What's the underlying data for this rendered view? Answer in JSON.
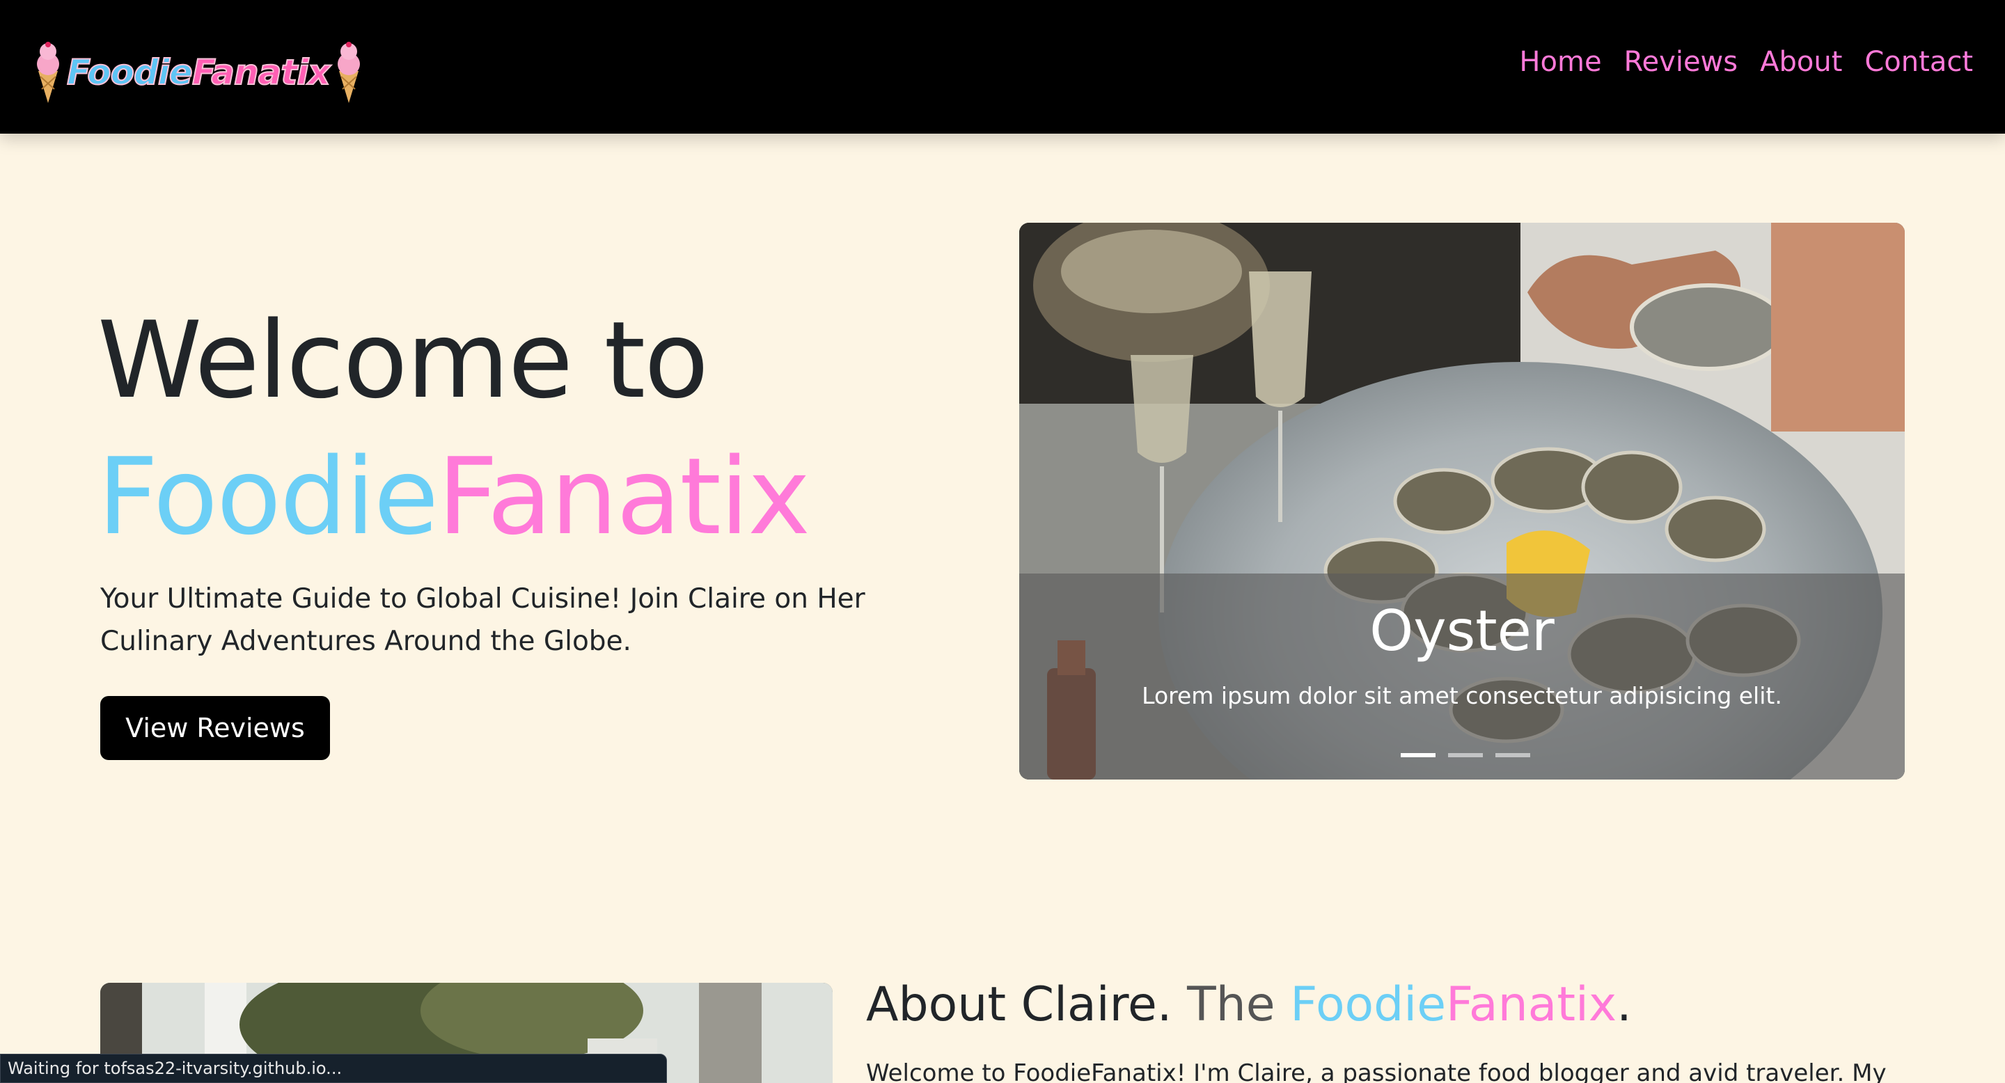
{
  "brand": {
    "part1": "Foodie",
    "part2": "Fanatix"
  },
  "nav": {
    "items": [
      "Home",
      "Reviews",
      "About",
      "Contact"
    ]
  },
  "hero": {
    "title_line1": "Welcome to",
    "title_part1": "Foodie",
    "title_part2": "Fanatix",
    "subtitle": "Your Ultimate Guide to Global Cuisine! Join Claire on Her Culinary Adventures Around the Globe.",
    "button": "View Reviews"
  },
  "carousel": {
    "caption_title": "Oyster",
    "caption_text": "Lorem ipsum dolor sit amet consectetur adipisicing elit.",
    "slide_count": 3,
    "active_slide": 1
  },
  "about": {
    "heading_part1": "About Claire.",
    "heading_part2": "The",
    "heading_part3": "Foodie",
    "heading_part4": "Fanatix",
    "heading_part5": ".",
    "text": "Welcome to FoodieFanatix! I'm Claire, a passionate food blogger and avid traveler. My"
  },
  "status_bar": {
    "text": "Waiting for tofsas22-itvarsity.github.io..."
  },
  "colors": {
    "accent_blue": "#6ccff6",
    "accent_pink": "#ff7ad9",
    "background": "#fdf5e4",
    "navbar": "#000000"
  }
}
